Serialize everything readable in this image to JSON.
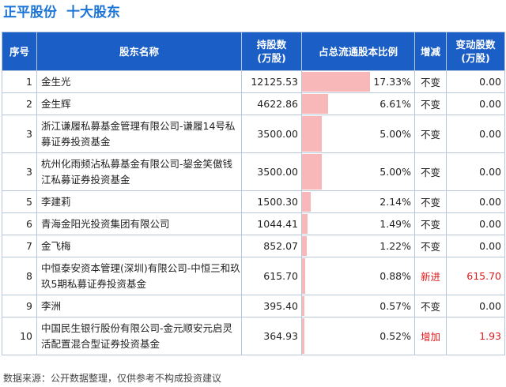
{
  "header": {
    "company": "正平股份",
    "subtitle": "十大股东"
  },
  "table": {
    "columns": [
      "序号",
      "股东名称",
      "持股数\n(万股)",
      "占总流通股本比例",
      "增减",
      "变动股数\n(万股)"
    ],
    "rows": [
      {
        "idx": "1",
        "name": "金生光",
        "shares": "12125.53",
        "ratio": "17.33%",
        "ratio_value": 17.33,
        "change": "不变",
        "delta": "0.00"
      },
      {
        "idx": "2",
        "name": "金生辉",
        "shares": "4622.86",
        "ratio": "6.61%",
        "ratio_value": 6.61,
        "change": "不变",
        "delta": "0.00"
      },
      {
        "idx": "3",
        "name": "浙江谦履私募基金管理有限公司-谦履14号私募证券投资基金",
        "shares": "3500.00",
        "ratio": "5.00%",
        "ratio_value": 5.0,
        "change": "不变",
        "delta": "0.00"
      },
      {
        "idx": "3",
        "name": "杭州化雨频沾私募基金有限公司-鋆金笑傲钱江私募证券投资基金",
        "shares": "3500.00",
        "ratio": "5.00%",
        "ratio_value": 5.0,
        "change": "不变",
        "delta": "0.00"
      },
      {
        "idx": "5",
        "name": "李建莉",
        "shares": "1500.30",
        "ratio": "2.14%",
        "ratio_value": 2.14,
        "change": "不变",
        "delta": "0.00"
      },
      {
        "idx": "6",
        "name": "青海金阳光投资集团有限公司",
        "shares": "1044.41",
        "ratio": "1.49%",
        "ratio_value": 1.49,
        "change": "不变",
        "delta": "0.00"
      },
      {
        "idx": "7",
        "name": "金飞梅",
        "shares": "852.07",
        "ratio": "1.22%",
        "ratio_value": 1.22,
        "change": "不变",
        "delta": "0.00"
      },
      {
        "idx": "8",
        "name": "中恒泰安资本管理(深圳)有限公司-中恒三和玖玖5期私募证券投资基金",
        "shares": "615.70",
        "ratio": "0.88%",
        "ratio_value": 0.88,
        "change": "新进",
        "delta": "615.70",
        "highlight": true
      },
      {
        "idx": "9",
        "name": "李洲",
        "shares": "395.40",
        "ratio": "0.57%",
        "ratio_value": 0.57,
        "change": "不变",
        "delta": "0.00"
      },
      {
        "idx": "10",
        "name": "中国民生银行股份有限公司-金元顺安元启灵活配置混合型证券投资基金",
        "shares": "364.93",
        "ratio": "0.52%",
        "ratio_value": 0.52,
        "change": "增加",
        "delta": "1.93",
        "highlight": true
      }
    ]
  },
  "footer": {
    "source": "数据来源：公开数据整理，仅供参考不构成投资建议"
  },
  "colors": {
    "header_bg": "#1b5fc6",
    "title": "#1a73d6",
    "bar": "#f8b8b9",
    "highlight": "#e0191b"
  }
}
